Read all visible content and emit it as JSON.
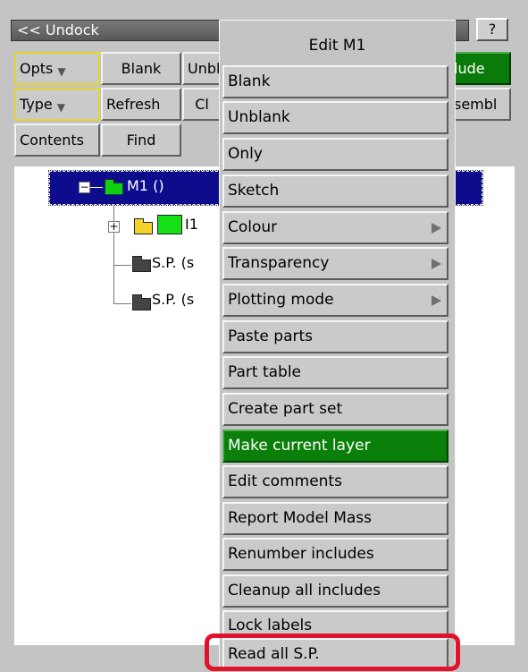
{
  "window": {
    "undock_label": "<< Undock",
    "help_label": "?"
  },
  "toolbar": {
    "opts": "Opts",
    "blank": "Blank",
    "unblank": "Unbl",
    "include": "lude",
    "type": "Type",
    "refresh": "Refresh",
    "clear": "Cl",
    "assembly": "sembl",
    "contents": "Contents",
    "find": "Find"
  },
  "tree": {
    "model": "M1 ()",
    "include": "I1",
    "sp1": "S.P. (s",
    "sp2": "S.P. (s"
  },
  "menu": {
    "title": "Edit M1",
    "items": [
      {
        "label": "Blank"
      },
      {
        "label": "Unblank"
      },
      {
        "label": "Only"
      },
      {
        "label": "Sketch"
      },
      {
        "label": "Colour"
      },
      {
        "label": "Transparency"
      },
      {
        "label": "Plotting mode"
      },
      {
        "label": "Paste parts"
      },
      {
        "label": "Part table"
      },
      {
        "label": "Create part set"
      },
      {
        "label": "Make current layer"
      },
      {
        "label": "Edit comments"
      },
      {
        "label": "Report Model Mass"
      },
      {
        "label": "Renumber includes"
      },
      {
        "label": "Cleanup all includes"
      },
      {
        "label": "Lock labels"
      },
      {
        "label": "Read all S.P."
      }
    ]
  },
  "colors": {
    "selection": "#0c0c8c",
    "highlight": "#0a800a",
    "callout": "#e0132a"
  }
}
